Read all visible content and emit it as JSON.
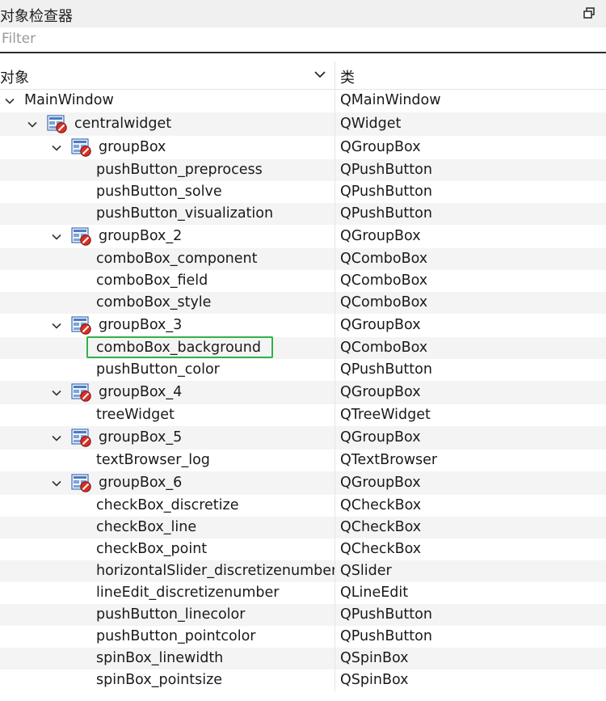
{
  "panel": {
    "title": "对象检查器"
  },
  "filter": {
    "placeholder": "Filter",
    "value": ""
  },
  "header": {
    "object_label": "对象",
    "class_label": "类"
  },
  "rows": [
    {
      "name": "MainWindow",
      "cls": "QMainWindow",
      "level": 0,
      "expandable": true,
      "icon": false
    },
    {
      "name": "centralwidget",
      "cls": "QWidget",
      "level": 1,
      "expandable": true,
      "icon": true
    },
    {
      "name": "groupBox",
      "cls": "QGroupBox",
      "level": 2,
      "expandable": true,
      "icon": true
    },
    {
      "name": "pushButton_preprocess",
      "cls": "QPushButton",
      "level": 3,
      "expandable": false,
      "icon": false
    },
    {
      "name": "pushButton_solve",
      "cls": "QPushButton",
      "level": 3,
      "expandable": false,
      "icon": false
    },
    {
      "name": "pushButton_visualization",
      "cls": "QPushButton",
      "level": 3,
      "expandable": false,
      "icon": false
    },
    {
      "name": "groupBox_2",
      "cls": "QGroupBox",
      "level": 2,
      "expandable": true,
      "icon": true
    },
    {
      "name": "comboBox_component",
      "cls": "QComboBox",
      "level": 3,
      "expandable": false,
      "icon": false
    },
    {
      "name": "comboBox_field",
      "cls": "QComboBox",
      "level": 3,
      "expandable": false,
      "icon": false
    },
    {
      "name": "comboBox_style",
      "cls": "QComboBox",
      "level": 3,
      "expandable": false,
      "icon": false
    },
    {
      "name": "groupBox_3",
      "cls": "QGroupBox",
      "level": 2,
      "expandable": true,
      "icon": true
    },
    {
      "name": "comboBox_background",
      "cls": "QComboBox",
      "level": 3,
      "expandable": false,
      "icon": false,
      "highlighted": true
    },
    {
      "name": "pushButton_color",
      "cls": "QPushButton",
      "level": 3,
      "expandable": false,
      "icon": false
    },
    {
      "name": "groupBox_4",
      "cls": "QGroupBox",
      "level": 2,
      "expandable": true,
      "icon": true
    },
    {
      "name": "treeWidget",
      "cls": "QTreeWidget",
      "level": 3,
      "expandable": false,
      "icon": false
    },
    {
      "name": "groupBox_5",
      "cls": "QGroupBox",
      "level": 2,
      "expandable": true,
      "icon": true
    },
    {
      "name": "textBrowser_log",
      "cls": "QTextBrowser",
      "level": 3,
      "expandable": false,
      "icon": false
    },
    {
      "name": "groupBox_6",
      "cls": "QGroupBox",
      "level": 2,
      "expandable": true,
      "icon": true
    },
    {
      "name": "checkBox_discretize",
      "cls": "QCheckBox",
      "level": 3,
      "expandable": false,
      "icon": false
    },
    {
      "name": "checkBox_line",
      "cls": "QCheckBox",
      "level": 3,
      "expandable": false,
      "icon": false
    },
    {
      "name": "checkBox_point",
      "cls": "QCheckBox",
      "level": 3,
      "expandable": false,
      "icon": false
    },
    {
      "name": "horizontalSlider_discretizenumber",
      "cls": "QSlider",
      "level": 3,
      "expandable": false,
      "icon": false
    },
    {
      "name": "lineEdit_discretizenumber",
      "cls": "QLineEdit",
      "level": 3,
      "expandable": false,
      "icon": false
    },
    {
      "name": "pushButton_linecolor",
      "cls": "QPushButton",
      "level": 3,
      "expandable": false,
      "icon": false
    },
    {
      "name": "pushButton_pointcolor",
      "cls": "QPushButton",
      "level": 3,
      "expandable": false,
      "icon": false
    },
    {
      "name": "spinBox_linewidth",
      "cls": "QSpinBox",
      "level": 3,
      "expandable": false,
      "icon": false
    },
    {
      "name": "spinBox_pointsize",
      "cls": "QSpinBox",
      "level": 3,
      "expandable": false,
      "icon": false
    }
  ],
  "colors": {
    "highlight_border": "#2fb24a",
    "alt_row": "#f4f4f4"
  },
  "icons": {
    "float": "float-dock-icon",
    "sort": "chevron-down-icon",
    "expand": "chevron-down-icon",
    "widget": "widget-layout-broken-icon"
  }
}
